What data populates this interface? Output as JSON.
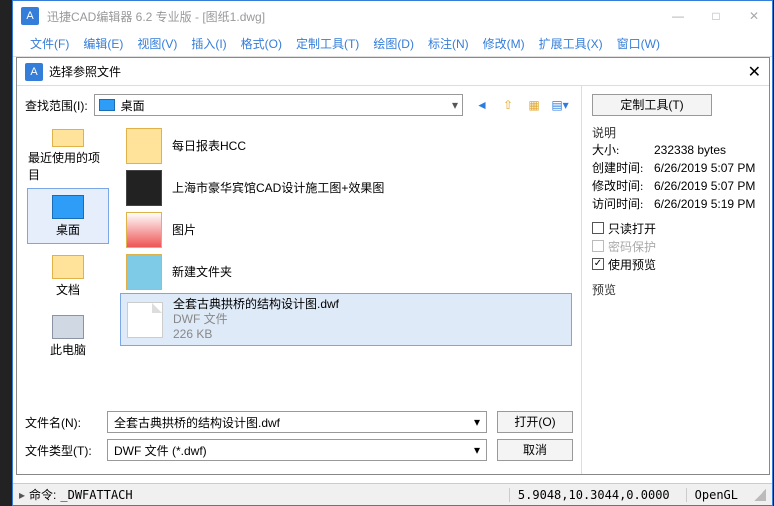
{
  "title": "迅捷CAD编辑器 6.2 专业版  - [图纸1.dwg]",
  "menus": [
    "文件(F)",
    "编辑(E)",
    "视图(V)",
    "插入(I)",
    "格式(O)",
    "定制工具(T)",
    "绘图(D)",
    "标注(N)",
    "修改(M)",
    "扩展工具(X)",
    "窗口(W)"
  ],
  "dialog": {
    "title": "选择参照文件",
    "lookLabel": "查找范围(I):",
    "lookValue": "桌面",
    "places": {
      "recent": "最近使用的项目",
      "desktop": "桌面",
      "docs": "文档",
      "pc": "此电脑"
    },
    "files": {
      "f0": {
        "name": "每日报表HCC"
      },
      "f1": {
        "name": "上海市豪华宾馆CAD设计施工图+效果图"
      },
      "f2": {
        "name": "图片"
      },
      "f3": {
        "name": "新建文件夹"
      },
      "f4": {
        "name": "全套古典拱桥的结构设计图.dwf",
        "type": "DWF 文件",
        "size": "226 KB"
      }
    },
    "fileNameLabel": "文件名(N):",
    "fileNameValue": "全套古典拱桥的结构设计图.dwf",
    "fileTypeLabel": "文件类型(T):",
    "fileTypeValue": "DWF 文件 (*.dwf)",
    "openBtn": "打开(O)",
    "cancelBtn": "取消"
  },
  "side": {
    "customBtn": "定制工具(T)",
    "infoTitle": "说明",
    "sizeK": "大小:",
    "sizeV": "232338 bytes",
    "ctimeK": "创建时间:",
    "ctimeV": "6/26/2019 5:07 PM",
    "mtimeK": "修改时间:",
    "mtimeV": "6/26/2019 5:07 PM",
    "atimeK": "访问时间:",
    "atimeV": "6/26/2019 5:19 PM",
    "readonly": "只读打开",
    "pwd": "密码保护",
    "preview": "使用预览",
    "previewTitle": "预览"
  },
  "status": {
    "cmdLabel": "命令:",
    "cmdValue": "_DWFATTACH",
    "coords": "5.9048,10.3044,0.0000",
    "gl": "OpenGL"
  }
}
